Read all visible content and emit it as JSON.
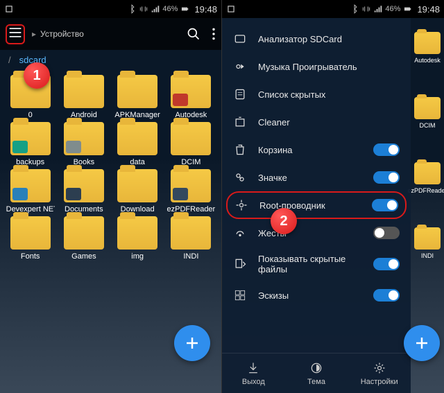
{
  "status": {
    "battery": "46%",
    "time": "19:48"
  },
  "left": {
    "markers": {
      "one": "1"
    },
    "breadcrumb": {
      "device": "Устройство"
    },
    "path": {
      "root": "/",
      "current": "sdcard"
    },
    "folders": [
      {
        "label": "0"
      },
      {
        "label": "Android"
      },
      {
        "label": "APKManager"
      },
      {
        "label": "Autodesk"
      },
      {
        "label": "backups"
      },
      {
        "label": "Books"
      },
      {
        "label": "data"
      },
      {
        "label": "DCIM"
      },
      {
        "label": "Devexpert NET"
      },
      {
        "label": "Documents"
      },
      {
        "label": "Download"
      },
      {
        "label": "ezPDFReader"
      },
      {
        "label": "Fonts"
      },
      {
        "label": "Games"
      },
      {
        "label": "img"
      },
      {
        "label": "INDI"
      }
    ]
  },
  "right": {
    "markers": {
      "two": "2"
    },
    "drawer_items": [
      {
        "label": "Анализатор SDCard",
        "toggle": null
      },
      {
        "label": "Музыка Проигрыватель",
        "toggle": null
      },
      {
        "label": "Список скрытых",
        "toggle": null
      },
      {
        "label": "Cleaner",
        "toggle": null
      },
      {
        "label": "Корзина",
        "toggle": true
      },
      {
        "label": "Значке",
        "toggle": true
      },
      {
        "label": "Root-проводник",
        "toggle": true,
        "highlight": true
      },
      {
        "label": "Жесты",
        "toggle": false
      },
      {
        "label": "Показывать скрытые файлы",
        "toggle": true
      },
      {
        "label": "Эскизы",
        "toggle": true
      }
    ],
    "bottom": [
      {
        "label": "Выход"
      },
      {
        "label": "Тема"
      },
      {
        "label": "Настройки"
      }
    ],
    "peek": [
      {
        "label": "Autodesk"
      },
      {
        "label": "DCIM"
      },
      {
        "label": "ezPDFReader"
      },
      {
        "label": "INDI"
      }
    ]
  }
}
